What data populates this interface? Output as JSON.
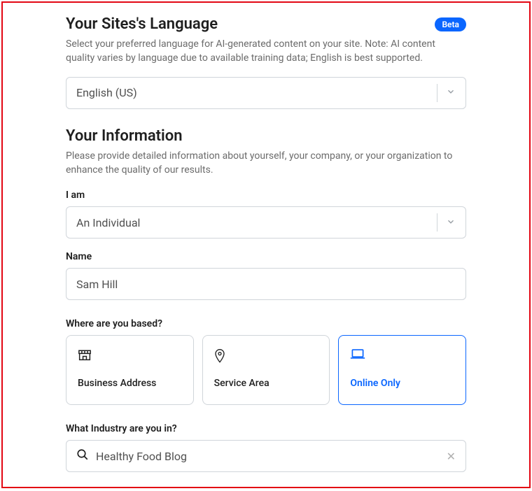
{
  "language": {
    "title": "Your Sites's Language",
    "badge": "Beta",
    "desc": "Select your preferred language for AI-generated content on your site. Note: AI content quality varies by language due to available training data; English is best supported.",
    "value": "English (US)"
  },
  "info": {
    "title": "Your Information",
    "desc": "Please provide detailed information about yourself, your company, or your organization to enhance the quality of our results.",
    "iam_label": "I am",
    "iam_value": "An Individual",
    "name_label": "Name",
    "name_value": "Sam Hill",
    "based_label": "Where are you based?",
    "cards": [
      {
        "label": "Business Address"
      },
      {
        "label": "Service Area"
      },
      {
        "label": "Online Only"
      }
    ],
    "industry_label": "What Industry are you in?",
    "industry_value": "Healthy Food Blog"
  }
}
